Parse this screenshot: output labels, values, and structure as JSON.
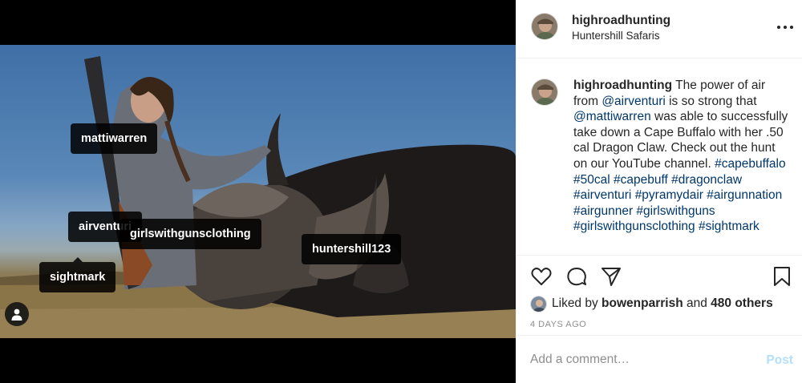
{
  "post": {
    "username": "highroadhunting",
    "location": "Huntershill Safaris"
  },
  "photo_tags": [
    {
      "label": "mattiwarren"
    },
    {
      "label": "airventuri"
    },
    {
      "label": "girlswithgunsclothing"
    },
    {
      "label": "huntershill123"
    },
    {
      "label": "sightmark"
    }
  ],
  "caption": {
    "username": "highroadhunting",
    "part1": " The power of air from ",
    "mention1": "@airventuri",
    "part2": " is so strong that ",
    "mention2": "@mattiwarren",
    "part3": " was able to successfully take down a Cape Buffalo with her .50 cal Dragon Claw. Check out the hunt on our YouTube channel. ",
    "hashtags": [
      "#capebuffalo",
      "#50cal",
      "#capebuff",
      "#dragonclaw",
      "#airventuri",
      "#pyramydair",
      "#airgunnation",
      "#airgunner",
      "#girlswithguns",
      "#girlswithgunsclothing",
      "#sightmark"
    ]
  },
  "likes": {
    "prefix": "Liked by ",
    "liker": "bowenparrish",
    "conjunction": " and ",
    "others": "480 others"
  },
  "timestamp": "4 DAYS AGO",
  "comment": {
    "placeholder": "Add a comment…",
    "post_label": "Post"
  },
  "icons": {
    "more": "more-options-icon",
    "like": "heart-icon",
    "comment": "comment-bubble-icon",
    "share": "paper-plane-icon",
    "save": "bookmark-icon",
    "user_tags": "user-silhouette-icon"
  },
  "colors": {
    "link": "#00376b",
    "text": "#262626",
    "muted": "#8e8e8e",
    "post_disabled": "#b2dffc"
  }
}
